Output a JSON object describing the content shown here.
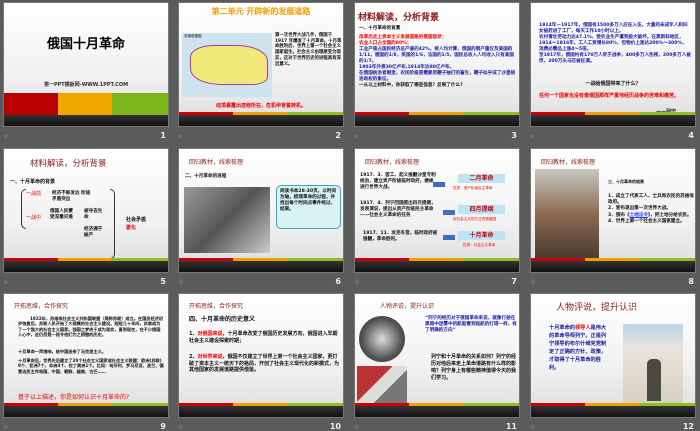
{
  "slides": [
    {
      "n": "1",
      "title": "俄国十月革命",
      "sub": "第一PPT模板网-WWW.1PPT.COM"
    },
    {
      "n": "2",
      "title": "第二单元 开辟新的发展道路",
      "map_label": "苏维埃俄国",
      "text": "第一次世界大战几件，俄国于1917 年爆发了十月革命。十月革命胜利后，世界上第一个社会主义国家诞生。社会主义由理想变为现实，这对于世界历史的进程具有深远意义。",
      "red": "动荡暴露出症结所在，危机孕育着转机。"
    },
    {
      "n": "3",
      "title": "材料解读，分析背景",
      "sub": "一、十月革命的背景",
      "bullets": [
        "改革后走上资本主义发展道路的俄国现状：",
        "农业人口占全国的80%；",
        "工业产值占国民经济总产值的42%，按人均计算，俄国的钢产量仅及美国的1/11，德国的1/8，英国的1/6，法国的1/5，国民总收入人均收入只有美国的1/7。",
        "1903年外债30亿卢布,1914年达80亿卢布。",
        "在俄国统治者眼里，农民阶级是需要用鞭子抽打的畜生，鞭子似乎成了沙皇统治政权的象征。",
        "一从以上材料中，你获取了哪些信息？反映了什么？"
      ]
    },
    {
      "n": "4",
      "bullets": [
        "1914年—1917年，俄国有1500多万人应征入伍，大量的未成年人和妇女被赶进了工厂，每天工作10小时以上。",
        "农村青壮劳动力达47.1%，使农业生产遭到极大破坏。在莫斯科地区，1914～1916年，工人工资增长80%，但物价上涨达200%～300%，消费必需品上涨4～5倍。",
        "至1917年，俄国约有170万人死于战争，400多万人伤残，200多万人被俘，200万头马匹被征调。"
      ],
      "question": "一战给俄国带来了什么？",
      "quote": "任何一个国家也没有像俄国那样严重地经历战争的苦难和痛苦。",
      "author": "——列宁"
    },
    {
      "n": "5",
      "title": "材料解读，分析背景",
      "sub": "一、十月革命的背景",
      "before": "一战前",
      "before_items": "经济不够发达 阶级矛盾突出",
      "during": "一战中",
      "during_a": "俄国人民蒙受深重灾难",
      "during_b": "被夺去生命",
      "during_c": "经济濒于破产",
      "result": "社会矛盾",
      "result_red": "激化"
    },
    {
      "n": "6",
      "title": "回归教材，线索梳理",
      "sub": "二、十月革命的进程",
      "callout": "阅读书本28-30页，以时间为轴，梳理革命的过程，并找出每个时间点事件经过、结果。"
    },
    {
      "n": "7",
      "title": "回归教材，线索梳理",
      "events": [
        {
          "text": "1917．3．罢工、起义推翻沙皇专制统治，建立资产阶级临时政府，继续进行世界大战。",
          "label": "二月革命",
          "note": "性质：资产阶级民主革命"
        },
        {
          "text": "1917．4．列宁回国提出四月提纲，发表演说，提出从资产阶级民主革命——社会主义革命的任务",
          "label": "四月提纲",
          "note": "用社会主义的方式改造俄国"
        },
        {
          "text": "1917．11．攻克冬宫，临时政府被推翻，革命胜利。",
          "label": "十月革命",
          "note": "性质：社会主义革命"
        }
      ]
    },
    {
      "n": "8",
      "title": "回归教材，线索梳理",
      "sub": "三、十月革命的结果",
      "items": [
        "1．成立了代表工人、士兵和农民的苏维埃政府。",
        "2．宣布退出第一次世界大战。",
        "3．颁布《",
        "土地法令",
        "》，把土地分给农民。",
        "4．世界上第一个社会主义国家建立。"
      ]
    },
    {
      "n": "9",
      "title": "开拓思维，合作探究",
      "p1": "1922年，苏维埃社会主义共和国联盟（简称苏联）成立。在国民经济初步恢复后，苏联人民开始了大规模的社会主义建设。短短几十年间，苏联成为了一个强大的社会主义国家。强国之梦终于成为现实，直到现在，在不少俄国人心中，这仍然是一段令他们为之骄傲的历史。",
      "p2": "十月革命一声炮响，给中国送来了马克思主义。",
      "p3": "十月革命后，世界先后建立了20个社会主义国家或社会主义联盟：欧洲(苏联) 9个、亚洲7个、非洲4个、拉丁美洲1个。比如：匈牙利、罗马尼亚、波兰、德意志民主共和国、中国、朝鲜、越南、古巴……",
      "q": "基于以上描述，你是如何认识十月革命的?"
    },
    {
      "n": "10",
      "title": "开拓思维，合作探究",
      "sub": "四、十月革命的历史意义",
      "i1a": "1、",
      "i1r": "对俄国来说",
      "i1": "，十月革命改变了俄国历史发展方向，俄国进入早期社会主义建设探索时期；",
      "i2a": "2、",
      "i2r": "对世界来说",
      "i2": "，俄国不仅建立了世界上第一个社会主义国家，更打破了资本主义一统天下的格局，开创了社会主义现代化的新模式，为其他国家的发展道路提供借鉴。"
    },
    {
      "n": "11",
      "title": "人物评说，提升认识",
      "quote": "“列宁的经历对于俄国革命来说，就像行驶在黑暗中迷雾中的航船看到指航的灯塔一样，有了明确的方向”",
      "q": "列宁和十月革命的关系如何？列宁的经历对他后来走上革命道路有什么样的影响？列宁身上有哪些精神值得今天的我们学习。"
    },
    {
      "n": "12",
      "title": "人物评说，提升认识",
      "a": "十月革命的",
      "r": "领导人",
      "b": "是伟大的革命导师列宁。正是列宁领导的布尔什维克党制定了正确的方针、政策，才取得了十月革命的胜利。"
    }
  ],
  "anim_icon": "☆"
}
